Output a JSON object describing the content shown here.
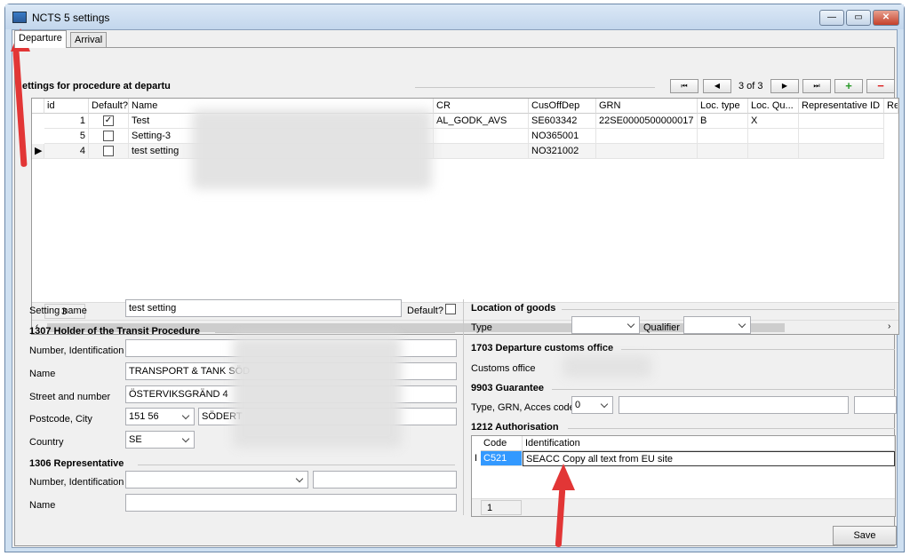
{
  "window": {
    "title": "NCTS 5 settings",
    "min": "—",
    "max": "▭",
    "close": "✕"
  },
  "tabs": [
    "Departure",
    "Arrival"
  ],
  "section_title": "ettings for procedure at departu",
  "nav": {
    "first": "⏮",
    "prev": "◀",
    "page": "3 of 3",
    "next": "▶",
    "last": "⏭",
    "add": "+",
    "remove": "−"
  },
  "grid": {
    "headers": [
      "id",
      "Default?",
      "Name",
      "CR",
      "CusOffDep",
      "GRN",
      "Loc. type",
      "Loc. Qu...",
      "Representative ID",
      "Re"
    ],
    "rows": [
      {
        "id": "1",
        "default": true,
        "name": "Test",
        "cr": "AL_GODK_AVS",
        "cusoffdep": "SE603342",
        "grn": "22SE0000500000017",
        "loctype": "B",
        "locqu": "X"
      },
      {
        "id": "5",
        "default": false,
        "name": "Setting-3",
        "cr": "",
        "cusoffdep": "NO365001",
        "grn": "",
        "loctype": "",
        "locqu": ""
      },
      {
        "id": "4",
        "default": false,
        "name": "test setting",
        "cr": "",
        "cusoffdep": "NO321002",
        "grn": "",
        "loctype": "",
        "locqu": ""
      }
    ],
    "footer_count": "3"
  },
  "form": {
    "setting_name_label": "Setting name",
    "setting_name": "test setting",
    "default_label": "Default?",
    "holder_title": "1307 Holder of the Transit Procedure",
    "number_ident_label": "Number, Identification",
    "name_label": "Name",
    "name_value": "TRANSPORT & TANK SÖD",
    "street_label": "Street and number",
    "street_value": "ÖSTERVIKSGRÄND 4",
    "postcode_label": "Postcode, City",
    "postcode_value": "151 56",
    "city_value": "SÖDERT",
    "country_label": "Country",
    "country_value": "SE",
    "rep_title": "1306 Representative",
    "rep_number_label": "Number, Identification",
    "rep_name_label": "Name"
  },
  "right": {
    "location_title": "Location of goods",
    "type_label": "Type",
    "qualifier_label": "Qualifier",
    "customs_title": "1703 Departure customs office",
    "customs_office_label": "Customs office",
    "guarantee_title": "9903 Guarantee",
    "guarantee_label": "Type, GRN, Acces code",
    "guarantee_type": "0",
    "auth_title": "1212 Authorisation",
    "auth_headers": [
      "Code",
      "Identification"
    ],
    "auth_row": {
      "code": "C521",
      "ident": "SEACC   Copy all text from EU site"
    },
    "auth_count": "1",
    "save_label": "Save"
  },
  "colors": {
    "highlight": "#3399ff",
    "arrow": "#e23636"
  }
}
